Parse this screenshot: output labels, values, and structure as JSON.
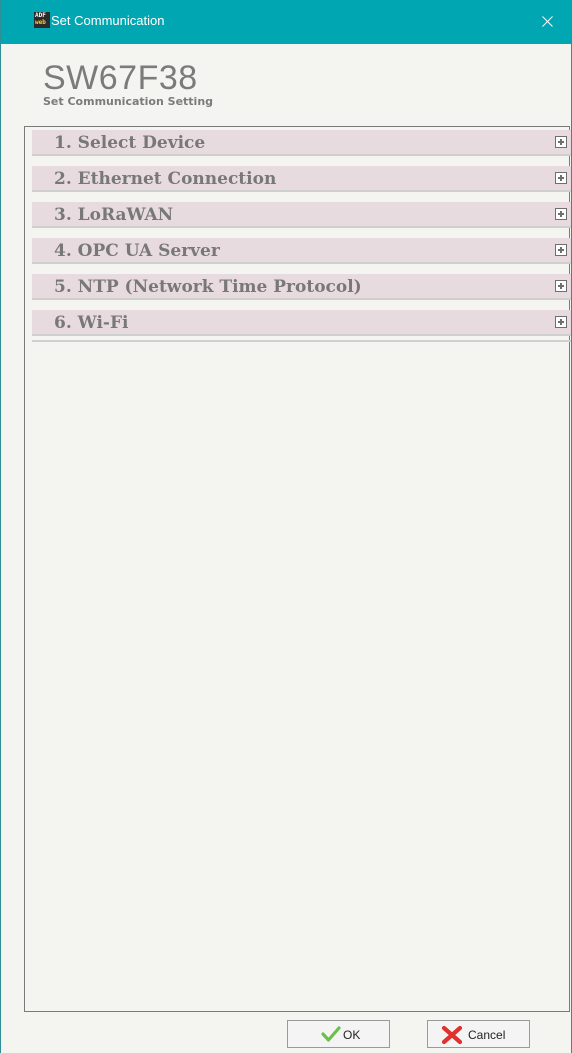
{
  "window": {
    "title": "Set Communication",
    "app_icon_top": "ADF",
    "app_icon_bottom": "web"
  },
  "header": {
    "product": "SW67F38",
    "subtitle": "Set Communication Setting"
  },
  "sections": [
    {
      "label": "1. Select Device"
    },
    {
      "label": "2. Ethernet Connection"
    },
    {
      "label": "3. LoRaWAN"
    },
    {
      "label": "4. OPC UA Server"
    },
    {
      "label": "5. NTP (Network Time Protocol)"
    },
    {
      "label": "6. Wi-Fi"
    }
  ],
  "footer": {
    "ok_label": "OK",
    "cancel_label": "Cancel"
  },
  "colors": {
    "titlebar": "#00a7b3",
    "section_bg": "#e8dbdf",
    "ok_check": "#6cc04a",
    "cancel_x": "#e0312f"
  }
}
